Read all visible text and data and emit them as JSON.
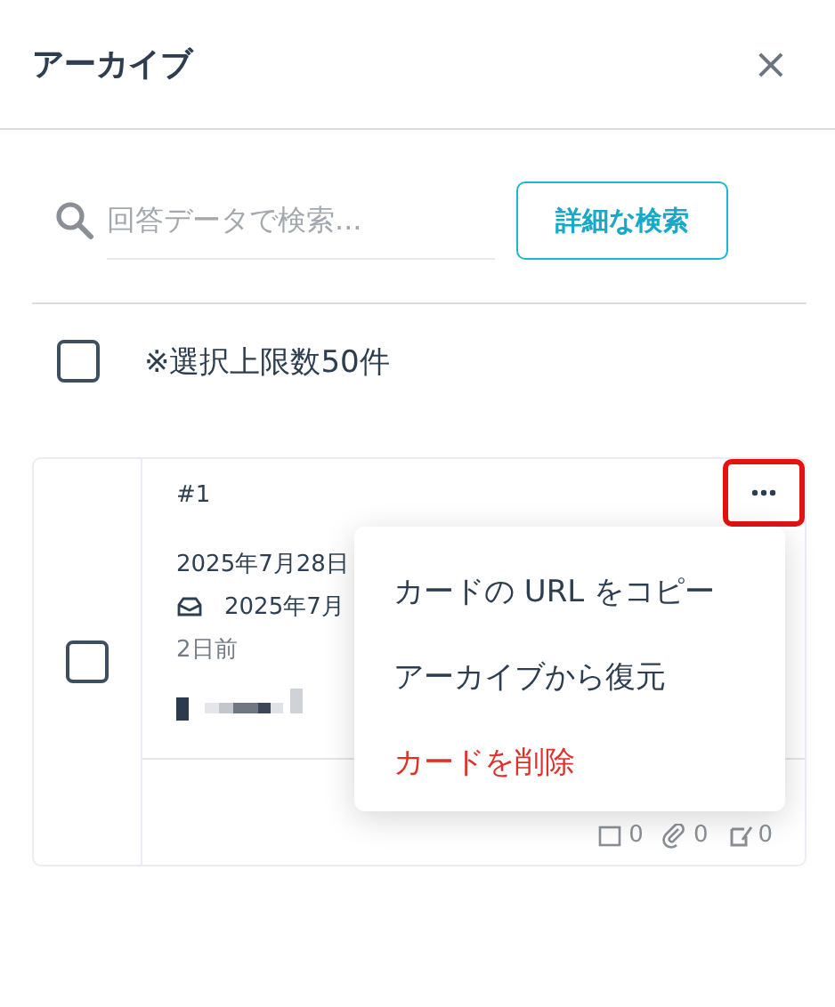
{
  "header": {
    "title": "アーカイブ",
    "close": "×"
  },
  "search": {
    "placeholder": "回答データで検索..."
  },
  "advanced_button": "詳細な検索",
  "select_all": {
    "checked": false,
    "label": "※選択上限数50件"
  },
  "cards": [
    {
      "checked": false,
      "number": "#1",
      "date": "2025年7月28日",
      "received": "2025年7月",
      "age": "2日前",
      "counts": [
        "0",
        "0",
        "0"
      ],
      "menu_highlighted": true
    }
  ],
  "menu": {
    "open": true,
    "items": [
      {
        "label": "カードの URL をコピー",
        "kind": "normal"
      },
      {
        "label": "アーカイブから復元",
        "kind": "normal"
      },
      {
        "label": "カードを削除",
        "kind": "danger"
      }
    ]
  }
}
